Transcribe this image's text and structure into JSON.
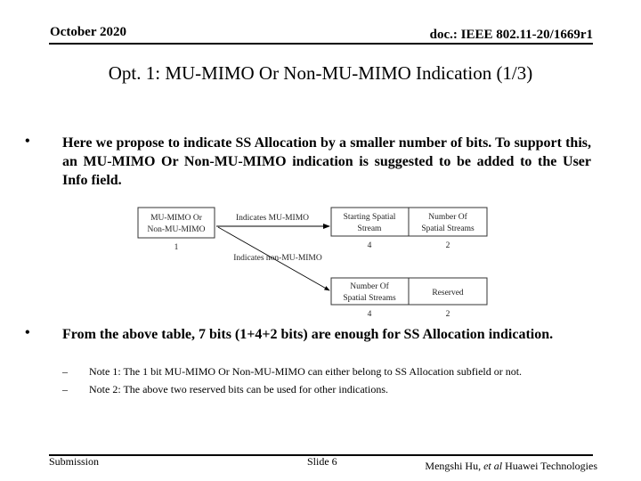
{
  "header": {
    "date": "October 2020",
    "doc_id": "doc.: IEEE 802.11-20/1669r1"
  },
  "title": "Opt. 1: MU-MIMO Or Non-MU-MIMO Indication (1/3)",
  "bullets": [
    {
      "symbol": "•",
      "text": "Here we propose to indicate SS Allocation by a smaller number of bits. To support this, an MU-MIMO Or Non-MU-MIMO indication is suggested to be added to the User Info field."
    },
    {
      "symbol": "•",
      "text": "From the above table, 7 bits (1+4+2 bits) are enough for SS Allocation indication."
    }
  ],
  "notes": [
    {
      "symbol": "–",
      "text": "Note 1: The 1 bit MU-MIMO Or Non-MU-MIMO can either belong to SS Allocation subfield or not."
    },
    {
      "symbol": "–",
      "text": "Note 2: The above two reserved bits can be used for other indications."
    }
  ],
  "diagram": {
    "source": {
      "line1": "MU-MIMO Or",
      "line2": "Non-MU-MIMO",
      "bits": "1"
    },
    "arrow_mu_label": "Indicates MU-MIMO",
    "arrow_non_mu_label": "Indicates non-MU-MIMO",
    "mu_fields": [
      {
        "line1": "Starting Spatial",
        "line2": "Stream",
        "bits": "4"
      },
      {
        "line1": "Number Of",
        "line2": "Spatial Streams",
        "bits": "2"
      }
    ],
    "non_mu_fields": [
      {
        "line1": "Number Of",
        "line2": "Spatial Streams",
        "bits": "4"
      },
      {
        "line1": "Reserved",
        "line2": "",
        "bits": "2"
      }
    ]
  },
  "footer": {
    "left": "Submission",
    "slide": "Slide 6",
    "author_name": "Mengshi Hu, ",
    "author_etal": "et al",
    "author_org": " Huawei Technologies"
  }
}
